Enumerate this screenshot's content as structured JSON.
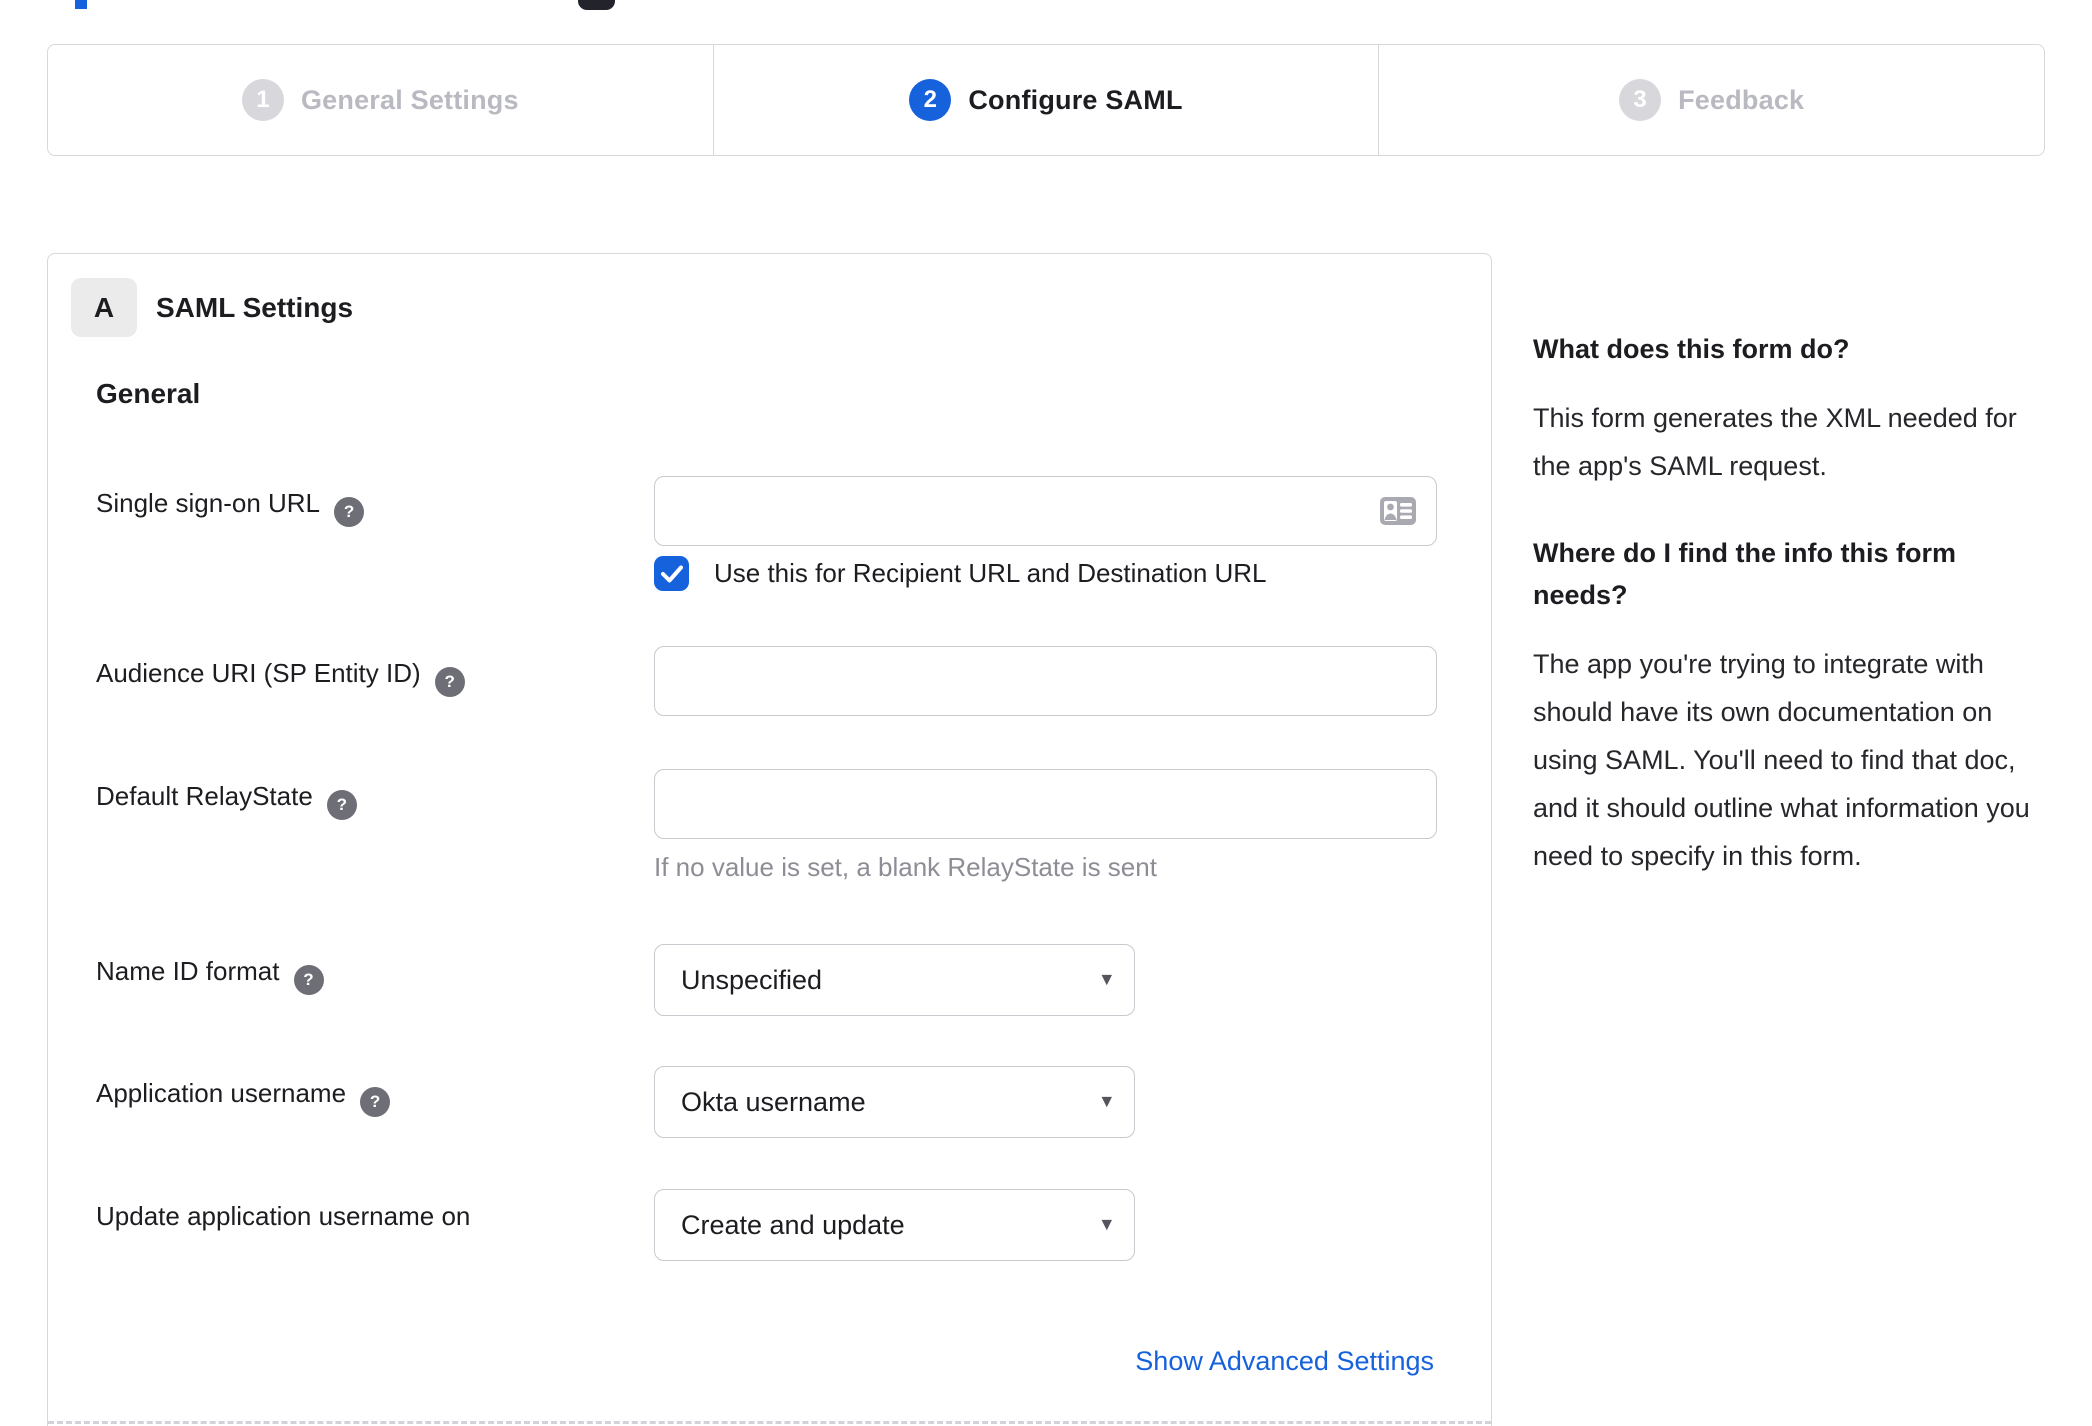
{
  "colors": {
    "accent": "#1662dd",
    "text": "#1d1d21",
    "inactive_step": "#b9b9c1",
    "border": "#d8d8dc",
    "hint": "#8d8d96"
  },
  "icons": {
    "help_glyph": "?",
    "caret_glyph": "▾",
    "check_glyph": "✓",
    "input_icon": "contact-card"
  },
  "stepper": {
    "active_step": 2,
    "steps": [
      {
        "number": "1",
        "label": "General Settings"
      },
      {
        "number": "2",
        "label": "Configure SAML"
      },
      {
        "number": "3",
        "label": "Feedback"
      }
    ]
  },
  "panel": {
    "badge": "A",
    "title": "SAML Settings",
    "section": "General",
    "rows": [
      {
        "label": "Single sign-on URL",
        "value": "",
        "checkbox": {
          "checked": true,
          "label": "Use this for Recipient URL and Destination URL"
        }
      },
      {
        "label": "Audience URI (SP Entity ID)",
        "value": ""
      },
      {
        "label": "Default RelayState",
        "value": "",
        "hint": "If no value is set, a blank RelayState is sent"
      },
      {
        "label": "Name ID format",
        "value": "Unspecified"
      },
      {
        "label": "Application username",
        "value": "Okta username"
      },
      {
        "label": "Update application username on",
        "value": "Create and update"
      }
    ],
    "advanced_link": "Show Advanced Settings"
  },
  "sidebar": {
    "heading1": "What does this form do?",
    "para1": "This form generates the XML needed for the app's SAML request.",
    "heading2": "Where do I find the info this form needs?",
    "para2": "The app you're trying to integrate with should have its own documentation on using SAML. You'll need to find that doc, and it should outline what information you need to specify in this form."
  }
}
